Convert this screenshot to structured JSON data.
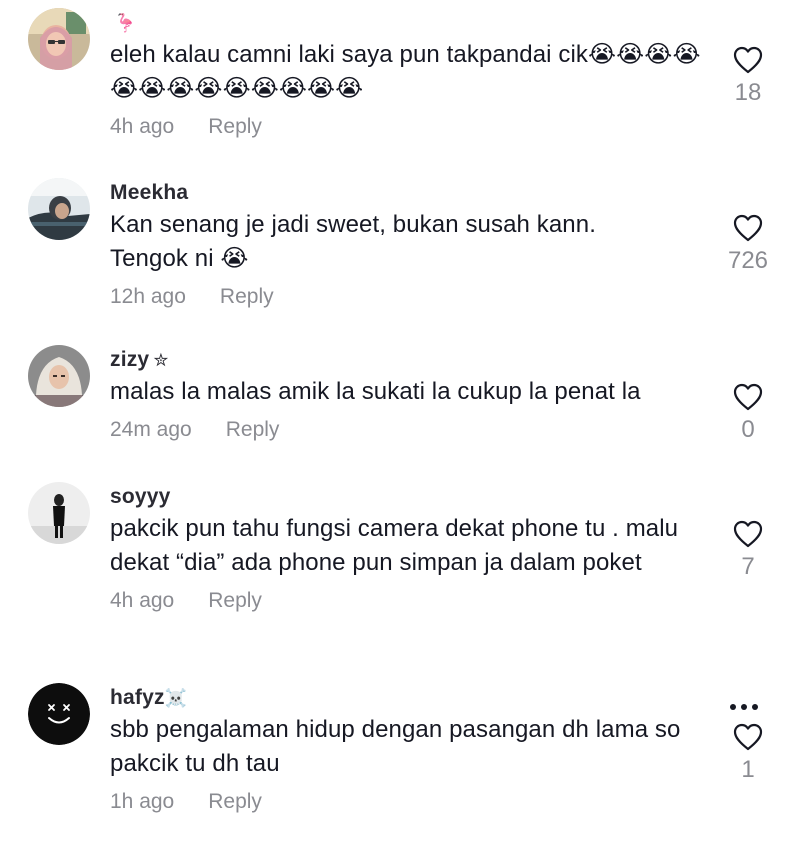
{
  "comments": [
    {
      "username": "",
      "username_emoji": "🦩",
      "text": "eleh kalau camni laki saya pun takpandai cik😭😭😭😭😭😭😭😭😭😭😭😭😭",
      "time": "4h ago",
      "reply_label": "Reply",
      "likes": "18"
    },
    {
      "username": "Meekha",
      "username_emoji": "",
      "text": "Kan senang je jadi sweet, bukan susah kann. Tengok ni 😭",
      "time": "12h ago",
      "reply_label": "Reply",
      "likes": "726"
    },
    {
      "username": "zizy",
      "username_emoji": "✮",
      "text": "malas la malas amik la sukati la cukup la penat la",
      "time": "24m ago",
      "reply_label": "Reply",
      "likes": "0"
    },
    {
      "username": "soyyy",
      "username_emoji": "",
      "text": "pakcik pun tahu fungsi camera dekat phone tu . malu dekat “dia” ada phone pun simpan ja dalam poket",
      "time": "4h ago",
      "reply_label": "Reply",
      "likes": "7"
    },
    {
      "username": "hafyz",
      "username_emoji": "☠️",
      "text": "sbb pengalaman hidup dengan pasangan dh lama so pakcik tu dh tau",
      "time": "1h ago",
      "reply_label": "Reply",
      "likes": "1"
    }
  ],
  "icons": {
    "heart": "heart-outline-icon",
    "more": "more-options-icon"
  },
  "colors": {
    "text": "#161823",
    "secondary": "#8a8b91"
  }
}
